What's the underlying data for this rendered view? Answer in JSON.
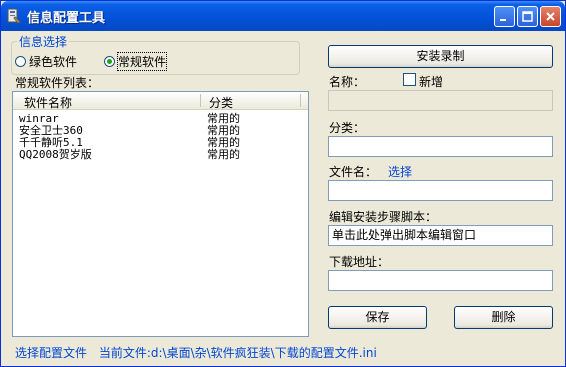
{
  "window": {
    "title": "信息配置工具"
  },
  "group": {
    "title": "信息选择",
    "options": [
      {
        "label": "绿色软件",
        "selected": false
      },
      {
        "label": "常规软件",
        "selected": true
      }
    ]
  },
  "list": {
    "title": "常规软件列表：",
    "columns": [
      "软件名称",
      "分类"
    ],
    "rows": [
      {
        "name": "winrar",
        "category": "常用的"
      },
      {
        "name": "安全卫士360",
        "category": "常用的"
      },
      {
        "name": "千千静听5.1",
        "category": "常用的"
      },
      {
        "name": "QQ2008贺岁版",
        "category": "常用的"
      }
    ]
  },
  "form": {
    "install_record_button": "安装录制",
    "name_label": "名称：",
    "new_label": "新增",
    "name_value": "",
    "category_label": "分类：",
    "category_value": "",
    "filename_label": "文件名：",
    "select_link": "选择",
    "filename_value": "",
    "script_label": "编辑安装步骤脚本：",
    "script_value": "单击此处弹出脚本编辑窗口",
    "download_label": "下载地址：",
    "download_value": "",
    "save_button": "保存",
    "delete_button": "删除"
  },
  "status": {
    "select_config": "选择配置文件",
    "current_file": "当前文件:d:\\桌面\\杂\\软件疯狂装\\下载的配置文件.ini"
  }
}
